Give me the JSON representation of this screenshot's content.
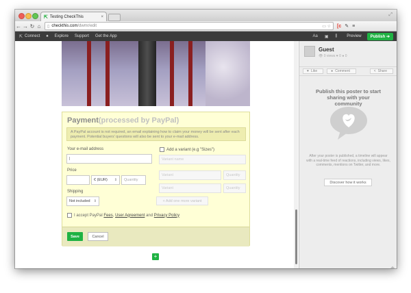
{
  "browser": {
    "tab_title": "Testing CheckThis",
    "url_host": "checkthis.com",
    "url_path": "/dwmr/edit"
  },
  "appbar": {
    "connect": "Connect",
    "explore": "Explore",
    "support": "Support",
    "get_app": "Get the App",
    "text_tool": "Aa",
    "preview": "Preview",
    "publish": "Publish ➔"
  },
  "form": {
    "title": "Payment",
    "title_sub": "(processed by PayPal)",
    "notice": "A PayPal account is not required, an email explaining how to claim your money will be sent after each payment. Potential buyers' questions will also be sent to your e-mail address.",
    "email_label": "Your e-mail address",
    "email_value": "|",
    "price_label": "Price",
    "currency": "€ (EUR)",
    "quantity_placeholder": "Quantity",
    "shipping_label": "Shipping",
    "shipping_value": "Not included",
    "variant_label": "Add a variant (e.g \"Sizes\")",
    "variant_name_placeholder": "Variant name",
    "variant_placeholder": "Variant",
    "add_variant": "+ Add one more variant",
    "terms_prefix": "I accept PayPal",
    "terms_fees": "Fees",
    "terms_sep": ",",
    "terms_agreement": "User Agreement",
    "terms_and": "and",
    "terms_privacy": "Privacy Policy",
    "save": "Save",
    "cancel": "Cancel",
    "add_block": "+"
  },
  "sidebar": {
    "user": "Guest",
    "stats": "👁 0 views  ♥ 0  ● 0",
    "like": "Like",
    "comment": "Comment",
    "share": "Share",
    "promo_title": "Publish this poster to start sharing with your community",
    "promo_text": "After your poster is published, a timeline will appear with a real-time feed of reactions, including views, likes, comments, mentions on Twitter, and more.",
    "discover": "Discover how it works"
  },
  "colors": {
    "accent_green": "#1fb243",
    "appbar_bg": "#3b3b3b",
    "form_bg": "#ffffd6"
  }
}
